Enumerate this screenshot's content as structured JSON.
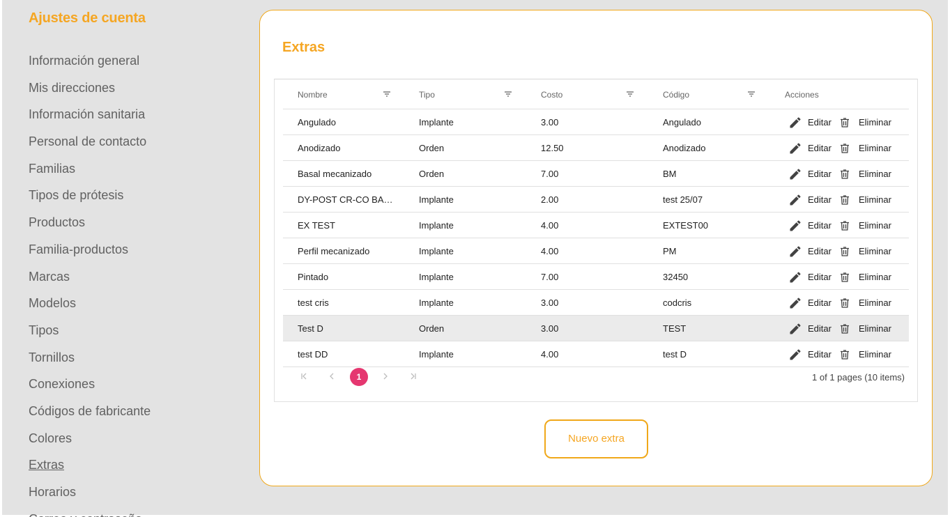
{
  "sidebar": {
    "title": "Ajustes de cuenta",
    "items": [
      {
        "label": "Información general"
      },
      {
        "label": "Mis direcciones"
      },
      {
        "label": "Información sanitaria"
      },
      {
        "label": "Personal de contacto"
      },
      {
        "label": "Familias"
      },
      {
        "label": "Tipos de prótesis"
      },
      {
        "label": "Productos"
      },
      {
        "label": "Familia-productos"
      },
      {
        "label": "Marcas"
      },
      {
        "label": "Modelos"
      },
      {
        "label": "Tipos"
      },
      {
        "label": "Tornillos"
      },
      {
        "label": "Conexiones"
      },
      {
        "label": "Códigos de fabricante"
      },
      {
        "label": "Colores"
      },
      {
        "label": "Extras",
        "active": true
      },
      {
        "label": "Horarios"
      },
      {
        "label": "Correo y contraseña"
      }
    ]
  },
  "main": {
    "title": "Extras",
    "table": {
      "columns": [
        "Nombre",
        "Tipo",
        "Costo",
        "Código",
        "Acciones"
      ],
      "edit_label": "Editar",
      "delete_label": "Eliminar",
      "rows": [
        {
          "nombre": "Angulado",
          "tipo": "Implante",
          "costo": "3.00",
          "codigo": "Angulado"
        },
        {
          "nombre": "Anodizado",
          "tipo": "Orden",
          "costo": "12.50",
          "codigo": "Anodizado"
        },
        {
          "nombre": "Basal mecanizado",
          "tipo": "Orden",
          "costo": "7.00",
          "codigo": "BM"
        },
        {
          "nombre": "DY-POST CR-CO BAS…",
          "tipo": "Implante",
          "costo": "2.00",
          "codigo": "test 25/07"
        },
        {
          "nombre": "EX TEST",
          "tipo": "Implante",
          "costo": "4.00",
          "codigo": "EXTEST00"
        },
        {
          "nombre": "Perfil mecanizado",
          "tipo": "Implante",
          "costo": "4.00",
          "codigo": "PM"
        },
        {
          "nombre": "Pintado",
          "tipo": "Implante",
          "costo": "7.00",
          "codigo": "32450"
        },
        {
          "nombre": "test cris",
          "tipo": "Implante",
          "costo": "3.00",
          "codigo": "codcris"
        },
        {
          "nombre": "Test D",
          "tipo": "Orden",
          "costo": "3.00",
          "codigo": "TEST",
          "selected": true
        },
        {
          "nombre": "test DD",
          "tipo": "Implante",
          "costo": "4.00",
          "codigo": "test D"
        }
      ]
    },
    "pager": {
      "current_page": "1",
      "info": "1 of 1 pages (10 items)"
    },
    "new_button_label": "Nuevo extra"
  },
  "colors": {
    "accent": "#f5a623",
    "pager_active": "#e53770",
    "background": "#e3e3e3"
  },
  "icons": [
    "filter-icon",
    "pencil-icon",
    "trash-icon",
    "first-page-icon",
    "prev-page-icon",
    "next-page-icon",
    "last-page-icon"
  ]
}
